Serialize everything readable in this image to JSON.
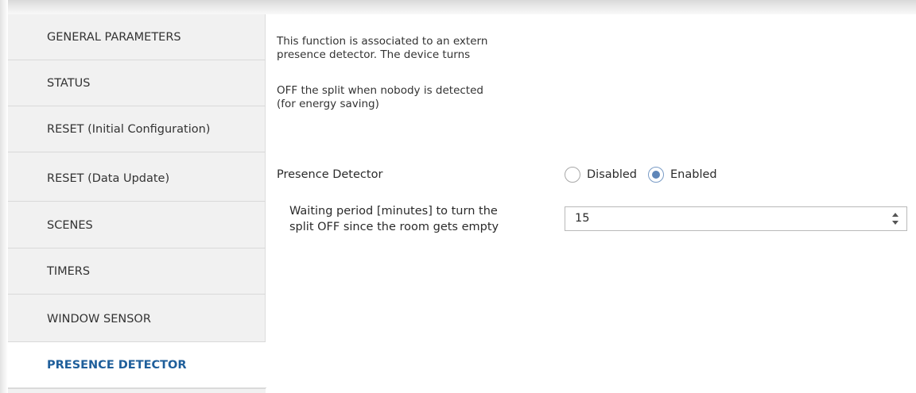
{
  "sidebar": {
    "items": [
      {
        "label": "GENERAL PARAMETERS"
      },
      {
        "label": "STATUS"
      },
      {
        "label": "RESET (Initial Configuration)"
      },
      {
        "label": "RESET (Data Update)"
      },
      {
        "label": "SCENES"
      },
      {
        "label": "TIMERS"
      },
      {
        "label": "WINDOW SENSOR"
      },
      {
        "label": "PRESENCE DETECTOR",
        "active": true
      }
    ]
  },
  "content": {
    "description_line1": "This function is associated to an extern",
    "description_line2": "presence detector. The device turns",
    "description_line3": "OFF the split when nobody is detected",
    "description_line4": "(for energy saving)",
    "presence_detector": {
      "label": "Presence Detector",
      "options": [
        {
          "label": "Disabled",
          "selected": false
        },
        {
          "label": "Enabled",
          "selected": true
        }
      ]
    },
    "waiting_period": {
      "label_line1": "Waiting period [minutes] to turn the",
      "label_line2": "split OFF since the room gets empty",
      "value": "15"
    }
  },
  "colors": {
    "active_nav_text": "#1f5f9b",
    "sidebar_bg": "#f1f1f1",
    "radio_selected": "#5f86b8"
  }
}
